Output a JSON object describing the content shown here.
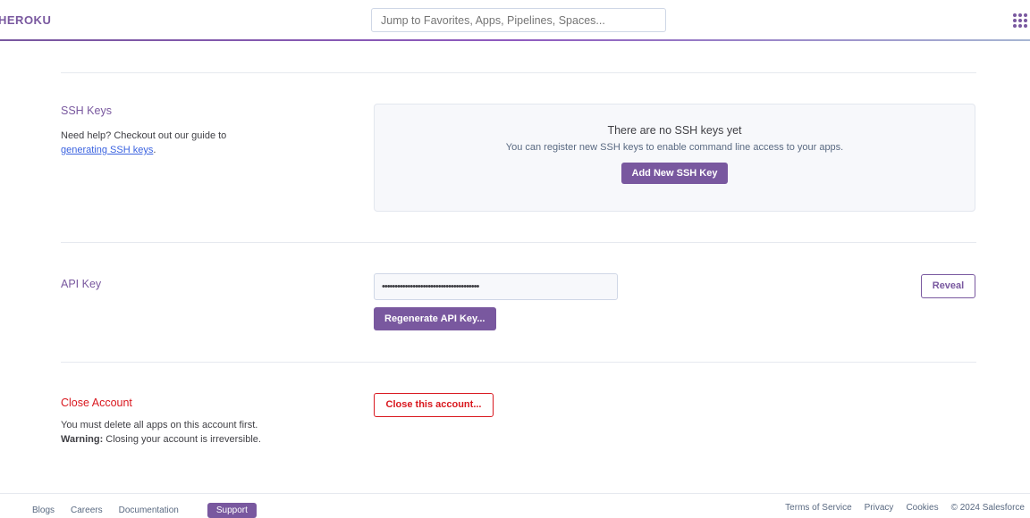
{
  "header": {
    "brand": "HEROKU",
    "search_placeholder": "Jump to Favorites, Apps, Pipelines, Spaces...",
    "apps_icon": "grid-dots-icon"
  },
  "ssh": {
    "title": "SSH Keys",
    "help_text": "Need help? Checkout out our guide to",
    "help_link": "generating SSH keys",
    "help_suffix": ".",
    "empty_heading": "There are no SSH keys yet",
    "empty_sub": "You can register new SSH keys to enable command line access to your apps.",
    "add_button": "Add New SSH Key"
  },
  "api": {
    "title": "API Key",
    "masked_value": "••••••••••••••••••••••••••••••••••••••",
    "reveal_button": "Reveal",
    "regenerate_button": "Regenerate API Key..."
  },
  "close_account": {
    "title": "Close Account",
    "line1": "You must delete all apps on this account first.",
    "warning_label": "Warning:",
    "warning_text": " Closing your account is irreversible.",
    "button": "Close this account..."
  },
  "footer": {
    "left_links": [
      "Blogs",
      "Careers",
      "Documentation"
    ],
    "left_pill": "Support",
    "right_links": [
      "Terms of Service",
      "Privacy",
      "Cookies",
      "© 2024 Salesforce"
    ]
  },
  "colors": {
    "brand_purple": "#79589f",
    "danger_red": "#d9181f"
  }
}
